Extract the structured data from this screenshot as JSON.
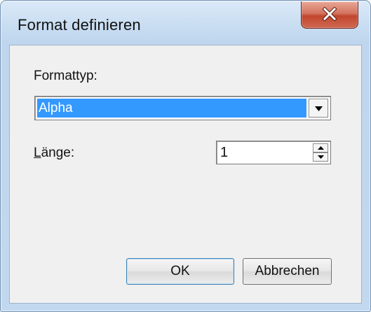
{
  "dialog": {
    "title": "Format definieren",
    "close_icon": "close-x-icon",
    "format_type_label": "Formattyp:",
    "format_type_value": "Alpha",
    "length_label_underlined_char": "L",
    "length_label_rest": "änge:",
    "length_value": "1",
    "ok_label": "OK",
    "cancel_label": "Abbrechen"
  },
  "colors": {
    "selection_highlight": "#3399ff",
    "close_button": "#c7503a",
    "title_bar": "#c7dcf1",
    "client_background": "#f0f0f0"
  },
  "icons": {
    "combo_arrow": "triangle-down-icon",
    "spin_up": "triangle-up-icon",
    "spin_down": "triangle-down-icon"
  }
}
